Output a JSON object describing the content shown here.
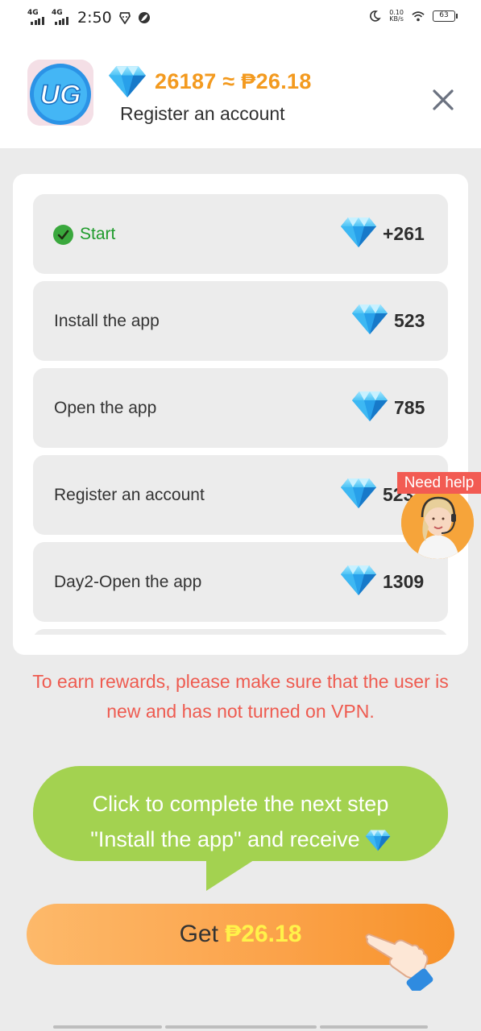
{
  "status_bar": {
    "network_tag_1": "4G",
    "network_tag_2": "4G",
    "time": "2:50",
    "net_speed_value": "0.10",
    "net_speed_unit": "KB/s",
    "battery": "63"
  },
  "header": {
    "reward_amount": "26187 ≈ ₱26.18",
    "task_title": "Register an account"
  },
  "steps": [
    {
      "label": "Start",
      "value": "+261",
      "done": true
    },
    {
      "label": "Install the app",
      "value": "523",
      "done": false
    },
    {
      "label": "Open the app",
      "value": "785",
      "done": false
    },
    {
      "label": "Register an account",
      "value": "523",
      "done": false
    },
    {
      "label": "Day2-Open the app",
      "value": "1309",
      "done": false
    }
  ],
  "help": {
    "label": "Need help"
  },
  "notice": "To earn rewards, please make sure that the user is new and has not turned on VPN.",
  "prompt": {
    "line1": "Click to complete the next step",
    "line2": "\"Install the app\" and receive"
  },
  "cta": {
    "prefix": "Get ",
    "amount": "₱26.18"
  },
  "colors": {
    "accent_orange": "#f39a1f",
    "done_green": "#1e9b2b",
    "notice_red": "#ee5b50",
    "bubble_green": "#a3d250",
    "help_red": "#f25b53",
    "cta_amount_yellow": "#fff24a"
  }
}
